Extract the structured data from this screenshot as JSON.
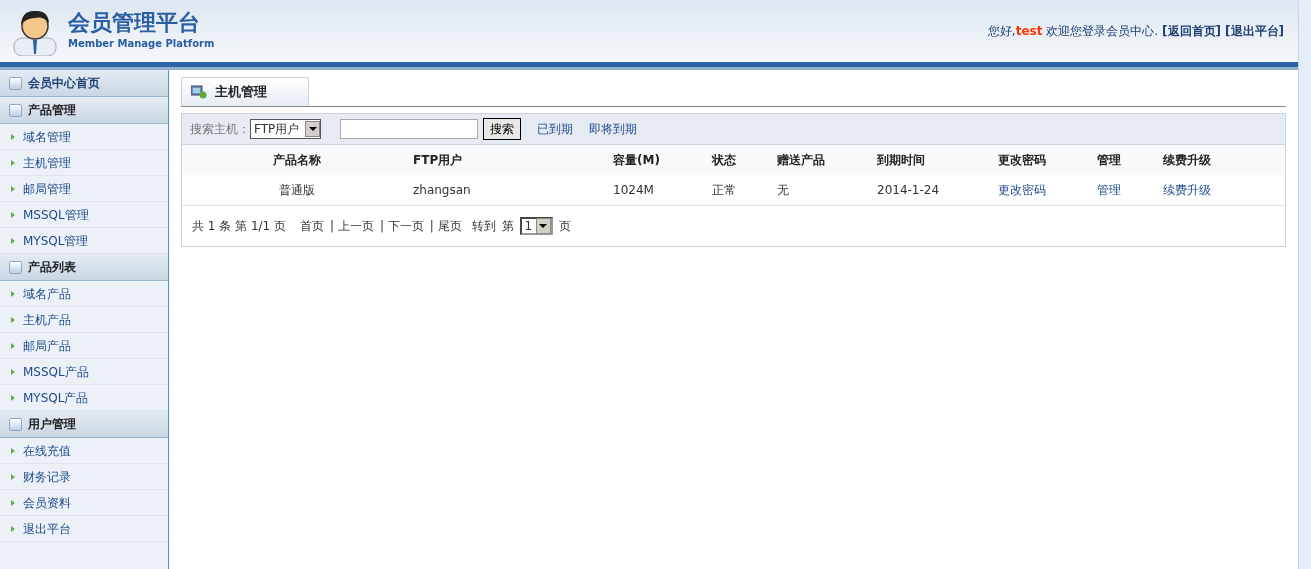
{
  "header": {
    "title": "会员管理平台",
    "subtitle": "Member Manage Platform",
    "greeting": "您好,",
    "user": "test",
    "welcome": "欢迎您登录会员中心.",
    "links": [
      "[返回首页]",
      "[退出平台]"
    ]
  },
  "sidebar": {
    "sections": [
      {
        "title": "会员中心首页"
      },
      {
        "title": "产品管理",
        "items": [
          "域名管理",
          "主机管理",
          "邮局管理",
          "MSSQL管理",
          "MYSQL管理"
        ]
      },
      {
        "title": "产品列表",
        "items": [
          "域名产品",
          "主机产品",
          "邮局产品",
          "MSSQL产品",
          "MYSQL产品"
        ]
      },
      {
        "title": "用户管理",
        "items": [
          "在线充值",
          "财务记录",
          "会员资料",
          "退出平台"
        ]
      }
    ]
  },
  "tab": {
    "label": "主机管理"
  },
  "search": {
    "label": "搜索主机：",
    "select": "FTP用户",
    "button": "搜索",
    "filters": [
      "已到期",
      "即将到期"
    ]
  },
  "table": {
    "columns": [
      "产品名称",
      "FTP用户",
      "容量(M)",
      "状态",
      "赠送产品",
      "到期时间",
      "更改密码",
      "管理",
      "续费升级"
    ],
    "rows": [
      {
        "cells": [
          "普通版",
          "zhangsan",
          "1024M",
          "正常",
          "无",
          "2014-1-24",
          "更改密码",
          "管理",
          "续费升级"
        ]
      }
    ]
  },
  "pager": {
    "summary": [
      "共",
      "1",
      "条",
      "第",
      "1/1",
      "页"
    ],
    "links": [
      "首页",
      "| 上一页",
      "| 下一页",
      "| 尾页"
    ],
    "goto": "转到",
    "page_prefix": "第",
    "page": "1",
    "page_suffix": "页"
  }
}
